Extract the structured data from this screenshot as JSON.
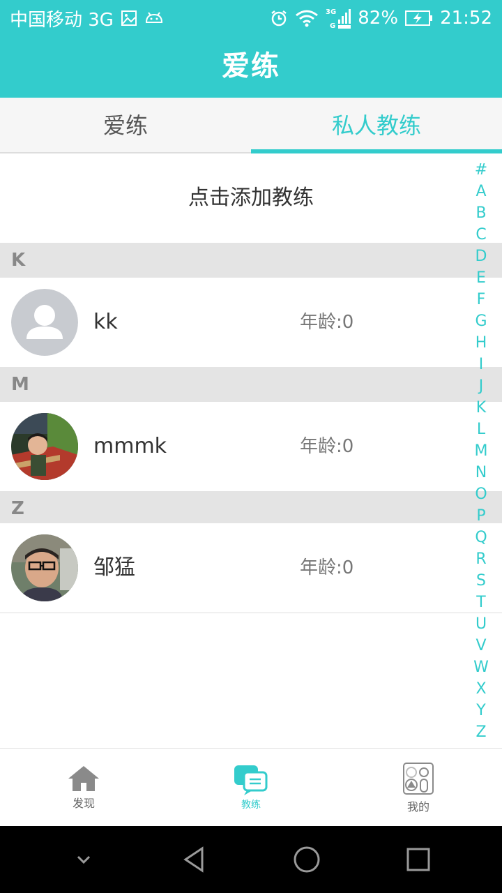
{
  "status_bar": {
    "carrier": "中国移动 3G",
    "battery": "82%",
    "time": "21:52"
  },
  "header": {
    "title": "爱练"
  },
  "tabs": [
    {
      "label": "爱练",
      "active": false
    },
    {
      "label": "私人教练",
      "active": true
    }
  ],
  "add_coach": "点击添加教练",
  "sections": [
    {
      "letter": "K",
      "items": [
        {
          "name": "kk",
          "age_label": "年龄:0"
        }
      ]
    },
    {
      "letter": "M",
      "items": [
        {
          "name": "mmmk",
          "age_label": "年龄:0"
        }
      ]
    },
    {
      "letter": "Z",
      "items": [
        {
          "name": "邹猛",
          "age_label": "年龄:0"
        }
      ]
    }
  ],
  "index_letters": [
    "#",
    "A",
    "B",
    "C",
    "D",
    "E",
    "F",
    "G",
    "H",
    "I",
    "J",
    "K",
    "L",
    "M",
    "N",
    "O",
    "P",
    "Q",
    "R",
    "S",
    "T",
    "U",
    "V",
    "W",
    "X",
    "Y",
    "Z"
  ],
  "bottom_nav": [
    {
      "label": "发现",
      "icon": "home-icon",
      "active": false
    },
    {
      "label": "教练",
      "icon": "chat-icon",
      "active": true
    },
    {
      "label": "我的",
      "icon": "profile-icon",
      "active": false
    }
  ],
  "colors": {
    "accent": "#33cccc",
    "section_bg": "#e4e4e4"
  }
}
